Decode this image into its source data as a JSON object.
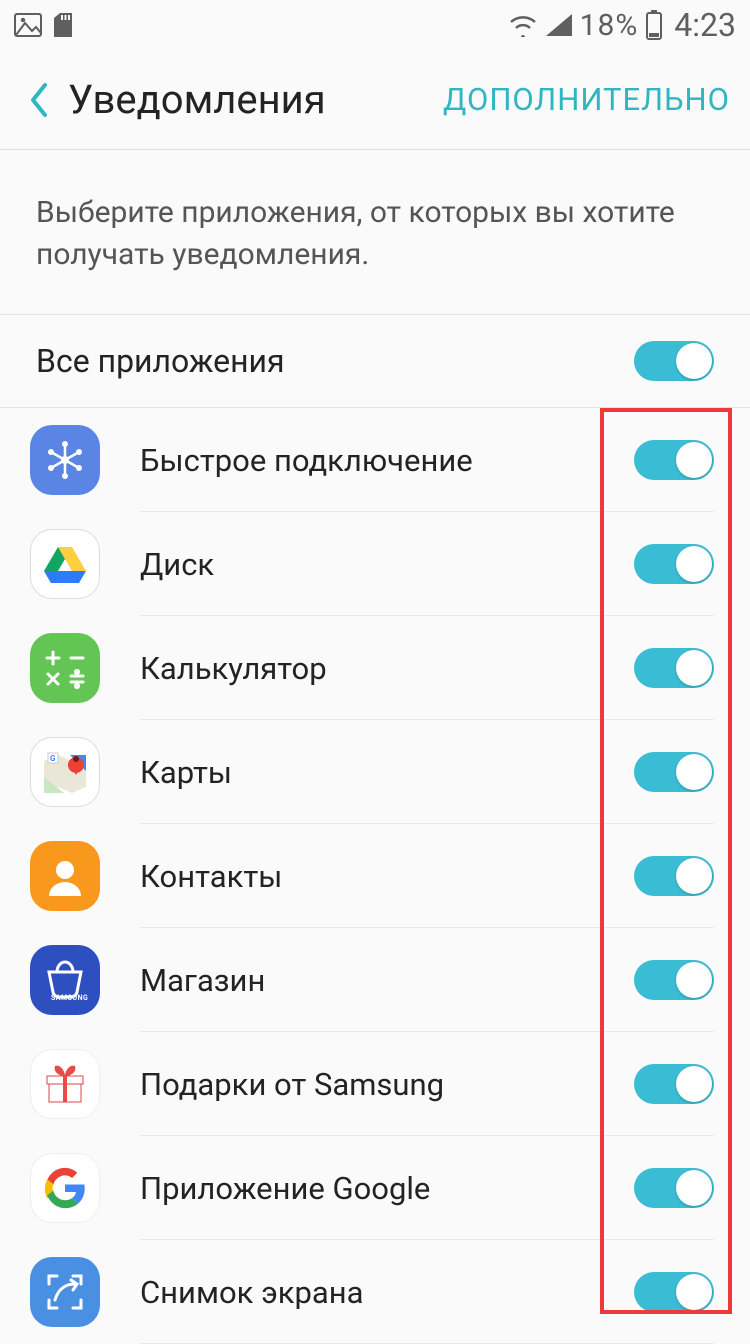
{
  "status": {
    "battery": "18%",
    "time": "4:23"
  },
  "header": {
    "title": "Уведомления",
    "action": "ДОПОЛНИТЕЛЬНО"
  },
  "description": "Выберите приложения, от которых вы хотите получать уведомления.",
  "all_apps_label": "Все приложения",
  "apps": [
    {
      "name": "Быстрое подключение",
      "icon": "quick"
    },
    {
      "name": "Диск",
      "icon": "drive"
    },
    {
      "name": "Калькулятор",
      "icon": "calc"
    },
    {
      "name": "Карты",
      "icon": "maps"
    },
    {
      "name": "Контакты",
      "icon": "contacts"
    },
    {
      "name": "Магазин",
      "icon": "store"
    },
    {
      "name": "Подарки от Samsung",
      "icon": "gifts"
    },
    {
      "name": "Приложение Google",
      "icon": "google"
    },
    {
      "name": "Снимок экрана",
      "icon": "screen"
    }
  ]
}
